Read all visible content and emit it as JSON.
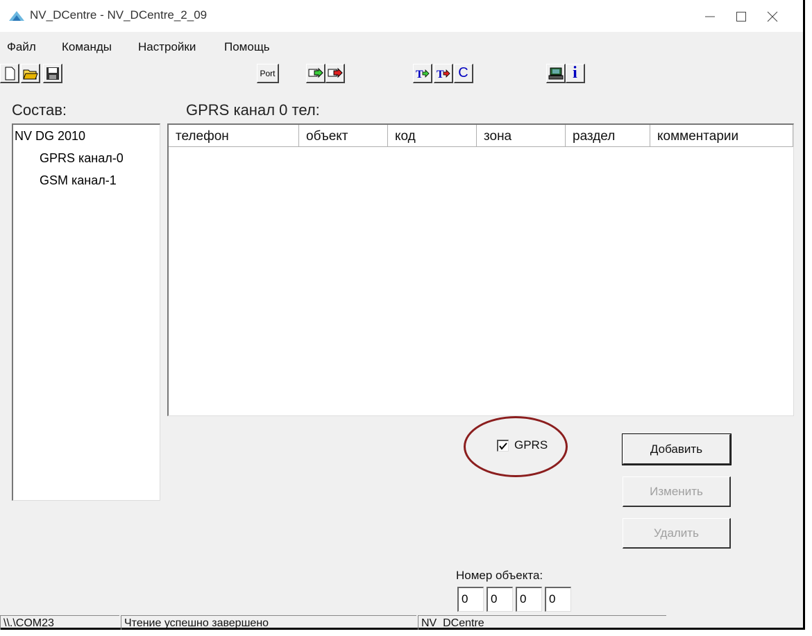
{
  "window": {
    "title": "NV_DCentre - NV_DCentre_2_09",
    "minimize_icon": "minimize-icon",
    "maximize_icon": "maximize-icon",
    "close_icon": "close-icon"
  },
  "menu": {
    "items": [
      "Файл",
      "Команды",
      "Настройки",
      "Помощь"
    ]
  },
  "toolbar": {
    "buttons": [
      "new-file-icon",
      "open-folder-icon",
      "save-icon",
      "port",
      "write-arrow-green-icon",
      "write-arrow-red-icon",
      "transfer-green-icon",
      "transfer-red-icon",
      "c-icon",
      "network-icon",
      "info-icon"
    ],
    "port_label": "Port",
    "c_label": "C",
    "info_label": "i"
  },
  "tree": {
    "heading": "Состав:",
    "items": [
      "NV DG 2010",
      "GPRS канал-0",
      "GSM канал-1"
    ]
  },
  "list": {
    "heading": "GPRS канал 0 тел:",
    "columns": [
      "телефон",
      "объект",
      "код",
      "зона",
      "раздел",
      "комментарии"
    ],
    "rows": []
  },
  "gprs": {
    "label": "GPRS",
    "checked": true,
    "highlight_color": "#8b1e1e"
  },
  "actions": {
    "add": "Добавить",
    "edit": "Изменить",
    "delete": "Удалить"
  },
  "object_number": {
    "label": "Номер объекта:",
    "digits": [
      "0",
      "0",
      "0",
      "0"
    ]
  },
  "status": {
    "port": "\\\\.\\COM23",
    "message": "Чтение успешно завершено",
    "app": "NV_DCentre"
  }
}
